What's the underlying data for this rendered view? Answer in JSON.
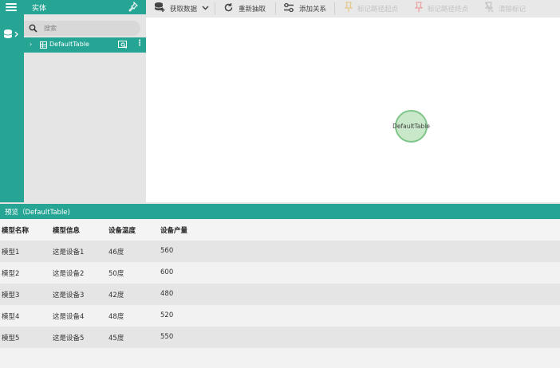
{
  "entities": {
    "title": "实体",
    "search_placeholder": "搜索",
    "items": [
      {
        "label": "DefaultTable"
      }
    ]
  },
  "toolbar": {
    "fetch_label": "获取数据",
    "reextract_label": "重新抽取",
    "add_relation_label": "添加关系",
    "mark_start_label": "标记路径起点",
    "mark_end_label": "标记路径终点",
    "clear_label": "清除标记"
  },
  "graph": {
    "nodes": [
      {
        "label": "DefaultTable"
      }
    ]
  },
  "preview": {
    "title": "预览（DefaultTable)",
    "columns": [
      "模型名称",
      "模型信息",
      "设备温度",
      "设备产量"
    ],
    "rows": [
      [
        "模型1",
        "这是设备1",
        "46度",
        "560"
      ],
      [
        "模型2",
        "这是设备2",
        "50度",
        "600"
      ],
      [
        "模型3",
        "这是设备3",
        "42度",
        "480"
      ],
      [
        "模型4",
        "这是设备4",
        "48度",
        "520"
      ],
      [
        "模型5",
        "这是设备5",
        "45度",
        "550"
      ]
    ]
  },
  "colors": {
    "accent": "#26a595",
    "node_fill": "#c9e8c9",
    "node_stroke": "#7fc58a",
    "disabled": "#c3c3c3"
  }
}
